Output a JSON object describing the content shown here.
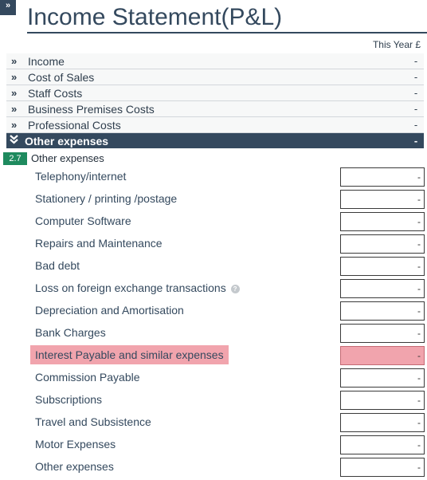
{
  "header": {
    "toggle_glyph": "»",
    "title": "Income Statement(P&L)",
    "column_label": "This Year £"
  },
  "sections": [
    {
      "label": "Income",
      "value": "-"
    },
    {
      "label": "Cost of Sales",
      "value": "-"
    },
    {
      "label": "Staff Costs",
      "value": "-"
    },
    {
      "label": "Business Premises Costs",
      "value": "-"
    },
    {
      "label": "Professional Costs",
      "value": "-"
    },
    {
      "label": "Other expenses",
      "value": "-"
    }
  ],
  "subsection": {
    "badge": "2.7",
    "title": "Other expenses"
  },
  "lines": [
    {
      "label": "Telephony/internet",
      "value": "-"
    },
    {
      "label": "Stationery / printing /postage",
      "value": "-"
    },
    {
      "label": "Computer Software",
      "value": "-"
    },
    {
      "label": "Repairs and Maintenance",
      "value": "-"
    },
    {
      "label": "Bad debt",
      "value": "-"
    },
    {
      "label": "Loss on foreign exchange transactions",
      "value": "-",
      "help": "?"
    },
    {
      "label": "Depreciation and Amortisation",
      "value": "-"
    },
    {
      "label": "Bank Charges",
      "value": "-"
    },
    {
      "label": "Interest Payable and similar expenses",
      "value": "-",
      "highlighted": true
    },
    {
      "label": "Commission Payable",
      "value": "-"
    },
    {
      "label": "Subscriptions",
      "value": "-"
    },
    {
      "label": "Travel and Subsistence",
      "value": "-"
    },
    {
      "label": "Motor Expenses",
      "value": "-"
    },
    {
      "label": "Other expenses",
      "value": "-"
    }
  ],
  "icons": {
    "collapsed": "chevron-double-right-icon",
    "expanded": "chevron-double-down-icon",
    "help": "question-circle-icon"
  },
  "colors": {
    "header_navy": "#34495e",
    "badge_green": "#1e8a5e",
    "error_pink": "#f1a4ad"
  }
}
